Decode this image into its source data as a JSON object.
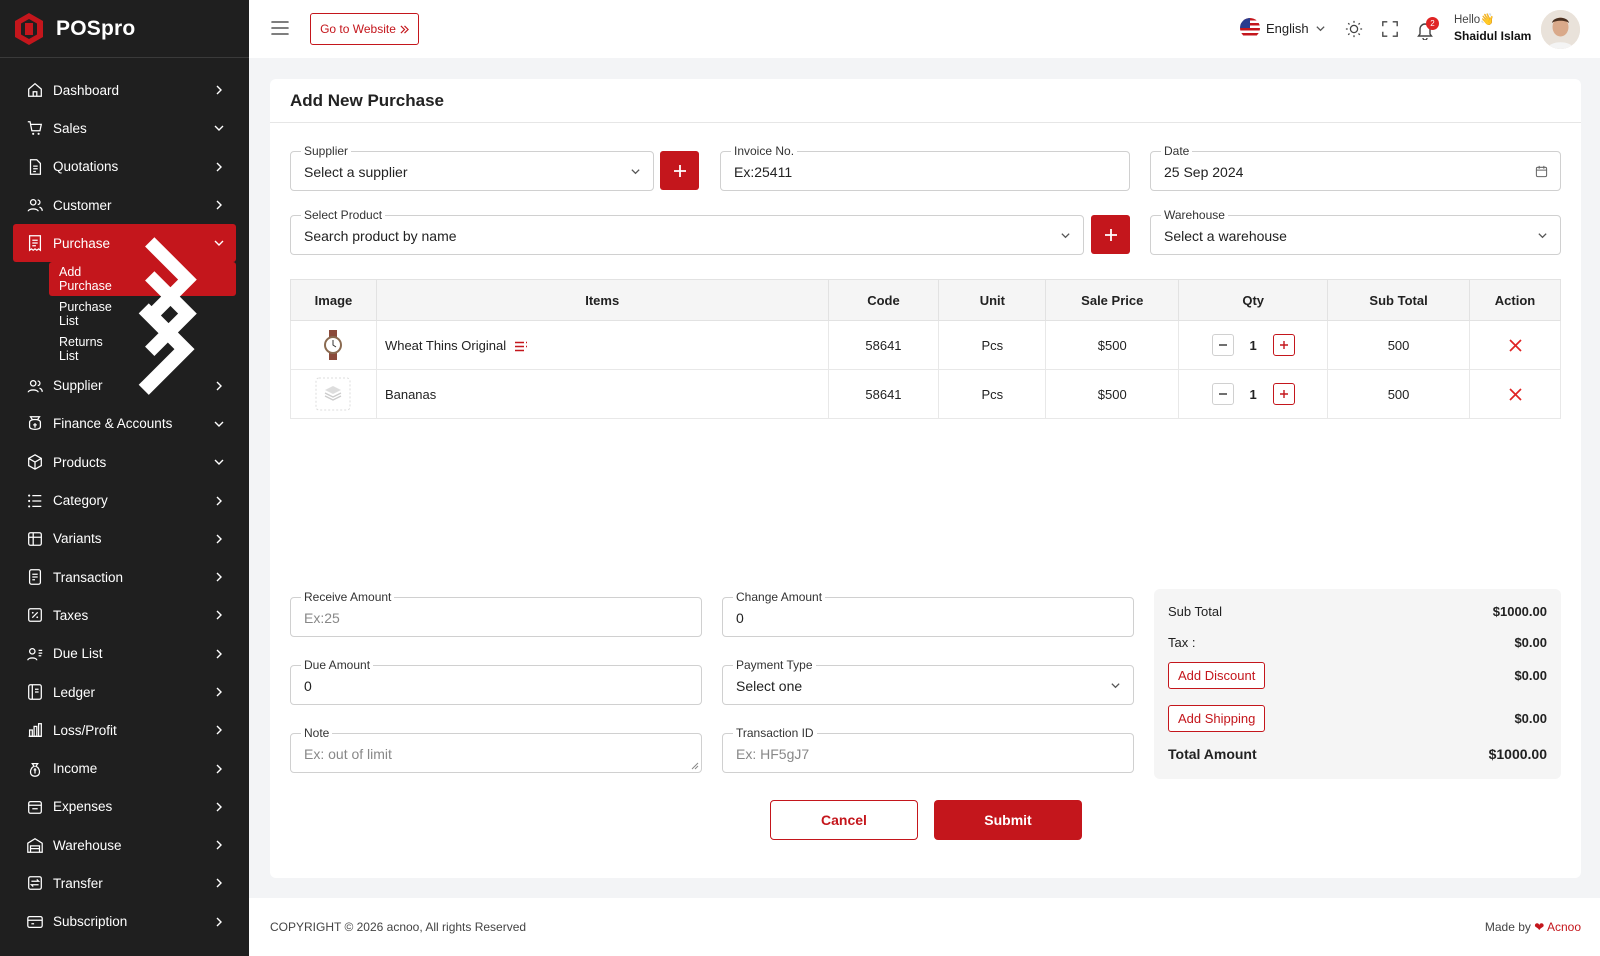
{
  "brand": {
    "name": "POSpro",
    "accent": "#c4161c"
  },
  "sidebar": {
    "items": [
      {
        "label": "Dashboard",
        "icon": "home-icon",
        "chev": "right"
      },
      {
        "label": "Sales",
        "icon": "cart-icon",
        "chev": "down"
      },
      {
        "label": "Quotations",
        "icon": "document-icon",
        "chev": "right"
      },
      {
        "label": "Customer",
        "icon": "users-icon",
        "chev": "right"
      },
      {
        "label": "Purchase",
        "icon": "receipt-icon",
        "chev": "down",
        "active": true
      },
      {
        "label": "Supplier",
        "icon": "users-icon",
        "chev": "right"
      },
      {
        "label": "Finance & Accounts",
        "icon": "finance-icon",
        "chev": "down"
      },
      {
        "label": "Products",
        "icon": "box-icon",
        "chev": "down"
      },
      {
        "label": "Category",
        "icon": "list-icon",
        "chev": "right"
      },
      {
        "label": "Variants",
        "icon": "variants-icon",
        "chev": "right"
      },
      {
        "label": "Transaction",
        "icon": "transaction-icon",
        "chev": "right"
      },
      {
        "label": "Taxes",
        "icon": "percent-icon",
        "chev": "right"
      },
      {
        "label": "Due List",
        "icon": "user-list-icon",
        "chev": "right"
      },
      {
        "label": "Ledger",
        "icon": "ledger-icon",
        "chev": "right"
      },
      {
        "label": "Loss/Profit",
        "icon": "chart-icon",
        "chev": "right"
      },
      {
        "label": "Income",
        "icon": "money-bag-icon",
        "chev": "right"
      },
      {
        "label": "Expenses",
        "icon": "expense-icon",
        "chev": "right"
      },
      {
        "label": "Warehouse",
        "icon": "warehouse-icon",
        "chev": "right"
      },
      {
        "label": "Transfer",
        "icon": "transfer-icon",
        "chev": "right"
      },
      {
        "label": "Subscription",
        "icon": "subscription-icon",
        "chev": "right"
      }
    ],
    "purchase_sub": [
      "Add Purchase",
      "Purchase List",
      "Returns List"
    ]
  },
  "topbar": {
    "go_website": "Go to Website",
    "language": "English",
    "notif_count": "2",
    "hello": "Hello",
    "wave": "👋",
    "user_name": "Shaidul Islam"
  },
  "page": {
    "title": "Add New Purchase"
  },
  "form": {
    "supplier": {
      "label": "Supplier",
      "value": "Select a supplier"
    },
    "invoice": {
      "label": "Invoice No.",
      "value": "Ex:25411"
    },
    "date": {
      "label": "Date",
      "value": "25 Sep 2024"
    },
    "product": {
      "label": "Select Product",
      "value": "Search product by name"
    },
    "warehouse": {
      "label": "Warehouse",
      "value": "Select a warehouse"
    },
    "receive": {
      "label": "Receive Amount",
      "placeholder": "Ex:25"
    },
    "change": {
      "label": "Change Amount",
      "value": "0"
    },
    "due": {
      "label": "Due Amount",
      "value": "0"
    },
    "payment": {
      "label": "Payment Type",
      "value": "Select one"
    },
    "note": {
      "label": "Note",
      "placeholder": "Ex: out of limit"
    },
    "txn": {
      "label": "Transaction ID",
      "placeholder": "Ex: HF5gJ7"
    }
  },
  "table": {
    "headers": [
      "Image",
      "Items",
      "Code",
      "Unit",
      "Sale Price",
      "Qty",
      "Sub Total",
      "Action"
    ],
    "rows": [
      {
        "item": "Wheat Thins Original",
        "code": "58641",
        "unit": "Pcs",
        "price": "$500",
        "qty": "1",
        "subtotal": "500"
      },
      {
        "item": "Bananas",
        "code": "58641",
        "unit": "Pcs",
        "price": "$500",
        "qty": "1",
        "subtotal": "500"
      }
    ]
  },
  "summary": {
    "subtotal_label": "Sub Total",
    "subtotal": "$1000.00",
    "tax_label": "Tax :",
    "tax": "$0.00",
    "discount_btn": "Add Discount",
    "discount": "$0.00",
    "shipping_btn": "Add Shipping",
    "shipping": "$0.00",
    "total_label": "Total Amount",
    "total": "$1000.00"
  },
  "actions": {
    "cancel": "Cancel",
    "submit": "Submit"
  },
  "footer": {
    "copyright": "COPYRIGHT © 2026 acnoo, All rights Reserved",
    "made_by": "Made by",
    "heart": "❤",
    "company": "Acnoo"
  }
}
